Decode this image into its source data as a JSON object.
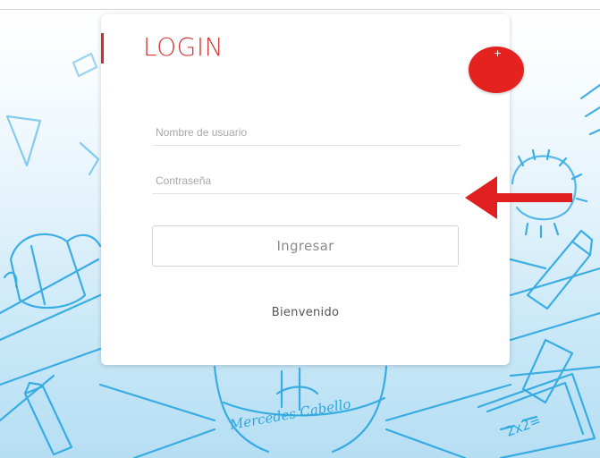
{
  "login": {
    "title": "LOGIN",
    "username_placeholder": "Nombre de usuario",
    "password_placeholder": "Contraseña",
    "submit_label": "Ingresar",
    "welcome_text": "Bienvenido"
  },
  "badge": {
    "symbol": "+"
  },
  "background": {
    "emblem_text": "Mercedes Cabello",
    "slate_text": "2x2="
  },
  "colors": {
    "accent": "#d63a3a",
    "dot": "#e4221f",
    "arrow": "#e02020",
    "doodle": "#2aa6e0"
  }
}
